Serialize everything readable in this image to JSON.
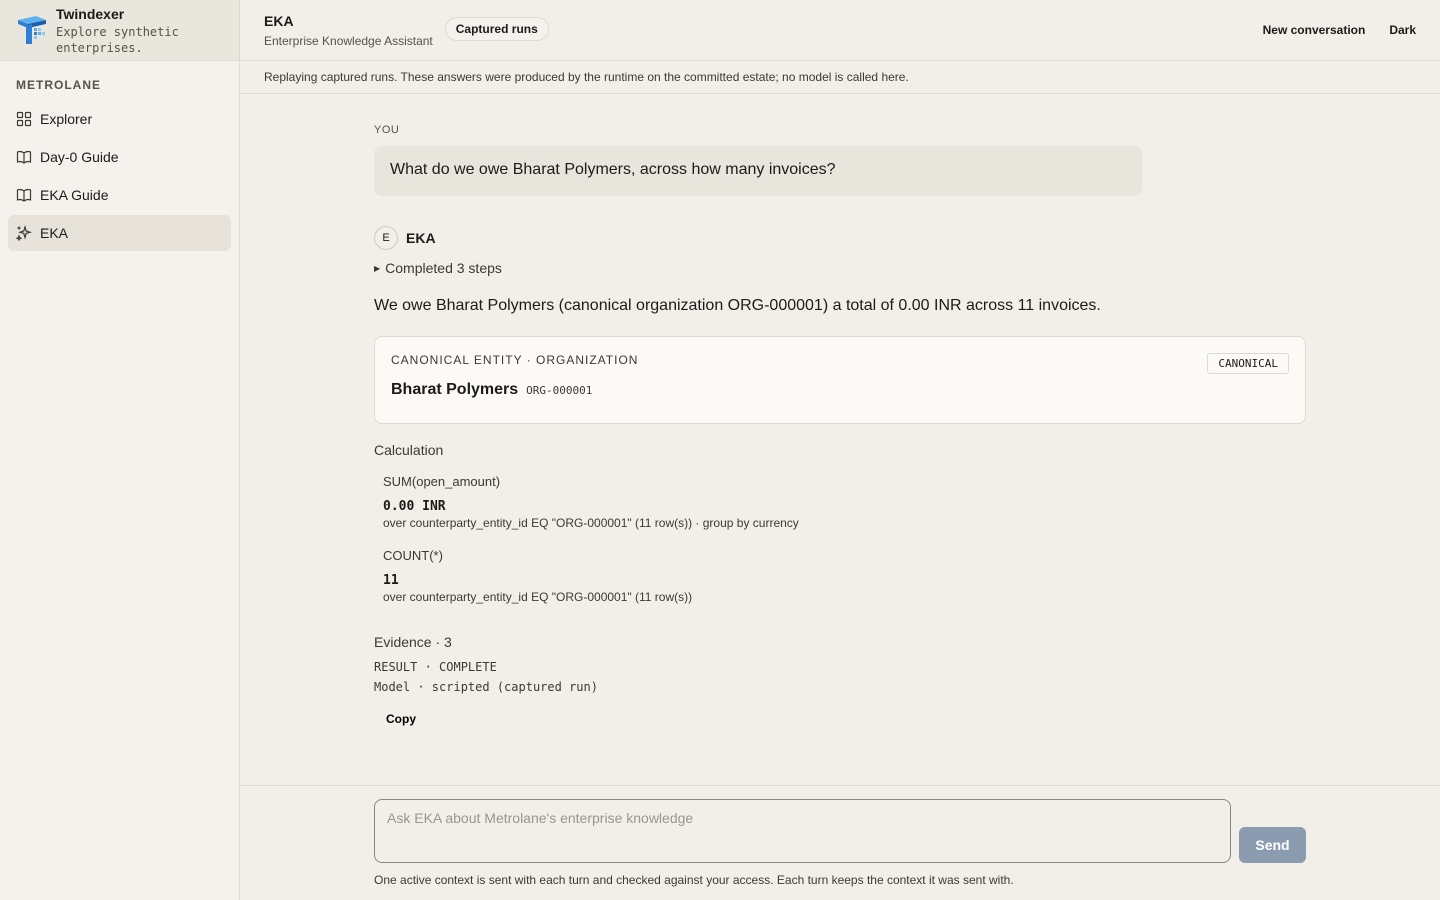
{
  "brand": {
    "name": "Twindexer",
    "tagline": "Explore synthetic enterprises."
  },
  "sidebar": {
    "workspace": "METROLANE",
    "items": [
      {
        "label": "Explorer",
        "icon": "grid-icon",
        "active": false
      },
      {
        "label": "Day-0 Guide",
        "icon": "book-icon",
        "active": false
      },
      {
        "label": "EKA Guide",
        "icon": "book-icon",
        "active": false
      },
      {
        "label": "EKA",
        "icon": "sparkle-icon",
        "active": true
      }
    ]
  },
  "header": {
    "title": "EKA",
    "subtitle": "Enterprise Knowledge Assistant",
    "pill": "Captured runs",
    "new_conversation": "New conversation",
    "theme": "Dark"
  },
  "banner": "Replaying captured runs. These answers were produced by the runtime on the committed estate; no model is called here.",
  "conversation": {
    "you_label": "YOU",
    "question": "What do we owe Bharat Polymers, across how many invoices?",
    "assistant_avatar": "E",
    "assistant_name": "EKA",
    "steps": "Completed 3 steps",
    "answer": "We owe Bharat Polymers (canonical organization ORG-000001) a total of 0.00 INR across 11 invoices."
  },
  "entity": {
    "eyebrow": "CANONICAL ENTITY · ORGANIZATION",
    "name": "Bharat Polymers",
    "id": "ORG-000001",
    "badge": "CANONICAL"
  },
  "calculation": {
    "title": "Calculation",
    "items": [
      {
        "fn": "SUM(open_amount)",
        "value": "0.00 INR",
        "desc": "over counterparty_entity_id EQ \"ORG-000001\" (11 row(s)) · group by currency"
      },
      {
        "fn": "COUNT(*)",
        "value": "11",
        "desc": "over counterparty_entity_id EQ \"ORG-000001\" (11 row(s))"
      }
    ]
  },
  "evidence": {
    "title": "Evidence · 3",
    "result": "RESULT · COMPLETE",
    "model": "Model · scripted (captured run)",
    "copy": "Copy"
  },
  "composer": {
    "placeholder": "Ask EKA about Metrolane's enterprise knowledge",
    "send": "Send",
    "note": "One active context is sent with each turn and checked against your access. Each turn keeps the context it was sent with."
  },
  "colors": {
    "send_button": "#8b9bb0",
    "logo_blue": "#2f7fd6",
    "background": "#f1efe8"
  }
}
